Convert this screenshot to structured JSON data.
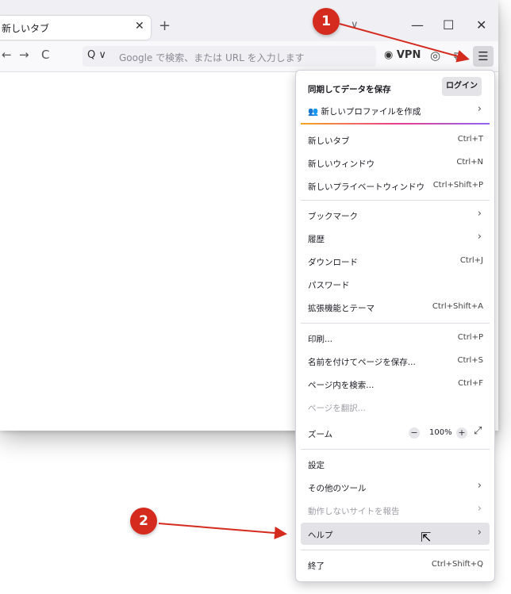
{
  "browser": {
    "tab": {
      "title": "新しいタブ",
      "close_icon": "close-icon"
    },
    "new_tab_label": "+",
    "tablist_chevron": "∨",
    "window_controls": {
      "minimize": "—",
      "maximize": "☐",
      "close": "✕"
    },
    "nav": {
      "back": "←",
      "forward": "→",
      "reload": "C"
    },
    "urlbar": {
      "search_engine": "Q ∨",
      "placeholder": "Google で検索、または URL を入力します"
    },
    "vpn_label": "VPN",
    "toolbar_icons": {
      "account": "account-icon",
      "extensions": "extensions-icon",
      "menu": "☰"
    }
  },
  "menu": {
    "sync_heading": "同期してデータを保存",
    "login_button": "ログイン",
    "new_profile": "新しいプロファイルを作成",
    "items": {
      "new_tab": {
        "label": "新しいタブ",
        "shortcut": "Ctrl+T"
      },
      "new_window": {
        "label": "新しいウィンドウ",
        "shortcut": "Ctrl+N"
      },
      "new_private_window": {
        "label": "新しいプライベートウィンドウ",
        "shortcut": "Ctrl+Shift+P"
      },
      "bookmarks": {
        "label": "ブックマーク"
      },
      "history": {
        "label": "履歴"
      },
      "downloads": {
        "label": "ダウンロード",
        "shortcut": "Ctrl+J"
      },
      "passwords": {
        "label": "パスワード"
      },
      "addons": {
        "label": "拡張機能とテーマ",
        "shortcut": "Ctrl+Shift+A"
      },
      "print": {
        "label": "印刷...",
        "shortcut": "Ctrl+P"
      },
      "save_page": {
        "label": "名前を付けてページを保存...",
        "shortcut": "Ctrl+S"
      },
      "find": {
        "label": "ページ内を検索...",
        "shortcut": "Ctrl+F"
      },
      "translate": {
        "label": "ページを翻訳..."
      },
      "zoom": {
        "label": "ズーム",
        "value": "100%",
        "minus": "−",
        "plus": "+",
        "fullscreen": "⤢"
      },
      "settings": {
        "label": "設定"
      },
      "more_tools": {
        "label": "その他のツール"
      },
      "report_site": {
        "label": "動作しないサイトを報告"
      },
      "help": {
        "label": "ヘルプ"
      },
      "quit": {
        "label": "終了",
        "shortcut": "Ctrl+Shift+Q"
      }
    }
  },
  "annotations": {
    "badge_1": "1",
    "badge_2": "2",
    "color": "#d52b1e"
  }
}
